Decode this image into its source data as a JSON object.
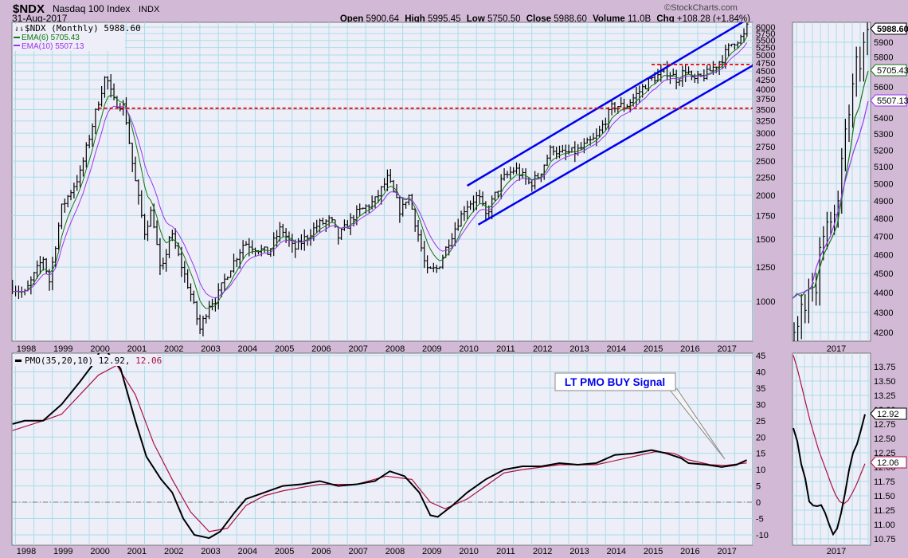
{
  "header": {
    "symbol": "$NDX",
    "name": "Nasdaq 100 Index",
    "exchange": "INDX",
    "date": "31-Aug-2017",
    "watermark": "©StockCharts.com",
    "open_label": "Open",
    "open": "5900.64",
    "high_label": "High",
    "high": "5995.45",
    "low_label": "Low",
    "low": "5750.50",
    "close_label": "Close",
    "close": "5988.60",
    "volume_label": "Volume",
    "volume": "11.0B",
    "chg_label": "Chg",
    "chg": "+108.28 (+1.84%)"
  },
  "legend": {
    "price": "$NDX (Monthly) 5988.60",
    "ema6": "EMA(6) 5705.43",
    "ema10": "EMA(10) 5507.13",
    "pmo": "PMO(35,20,10) 12.92,",
    "pmo_signal": "12.06"
  },
  "annotation": {
    "text": "LT PMO BUY Signal",
    "color": "#0000ee"
  },
  "colors": {
    "background": "#d2bad7",
    "panel": "#eeeef8",
    "grid": "#a8dde8",
    "ema6": "#117711",
    "ema10": "#9933ee",
    "pmo": "#000000",
    "signal": "#aa1144",
    "channel": "#0000ee",
    "support": "#ee0000"
  },
  "chart_data": [
    {
      "type": "ohlc",
      "title": "$NDX (Monthly)",
      "scale": "log",
      "ylim": [
        870,
        6300
      ],
      "y_ticks": [
        "6000",
        "5750",
        "5500",
        "5250",
        "5000",
        "4750",
        "4500",
        "4250",
        "4000",
        "3750",
        "3500",
        "3250",
        "3000",
        "2750",
        "2500",
        "2250",
        "2000",
        "1750",
        "1500",
        "1250",
        "1000"
      ],
      "x_ticks": [
        "1998",
        "1999",
        "2000",
        "2001",
        "2002",
        "2003",
        "2004",
        "2005",
        "2006",
        "2007",
        "2008",
        "2009",
        "2010",
        "2011",
        "2012",
        "2013",
        "2014",
        "2015",
        "2016",
        "2017"
      ],
      "xlim": [
        1997.67,
        2017.75
      ],
      "close_keypoints": [
        [
          1997.67,
          1100
        ],
        [
          1998.0,
          1050
        ],
        [
          1998.5,
          1330
        ],
        [
          1998.67,
          1140
        ],
        [
          1999.0,
          1840
        ],
        [
          1999.5,
          2300
        ],
        [
          2000.0,
          3700
        ],
        [
          2000.2,
          4400
        ],
        [
          2000.4,
          3700
        ],
        [
          2000.7,
          3570
        ],
        [
          2000.95,
          2340
        ],
        [
          2001.25,
          1570
        ],
        [
          2001.45,
          1830
        ],
        [
          2001.7,
          1170
        ],
        [
          2001.95,
          1580
        ],
        [
          2002.5,
          1050
        ],
        [
          2002.75,
          830
        ],
        [
          2003.0,
          985
        ],
        [
          2003.2,
          1020
        ],
        [
          2003.5,
          1200
        ],
        [
          2003.95,
          1470
        ],
        [
          2004.6,
          1370
        ],
        [
          2004.95,
          1620
        ],
        [
          2005.3,
          1400
        ],
        [
          2005.95,
          1650
        ],
        [
          2006.3,
          1700
        ],
        [
          2006.5,
          1520
        ],
        [
          2006.95,
          1760
        ],
        [
          2007.5,
          1930
        ],
        [
          2007.85,
          2240
        ],
        [
          2008.2,
          1780
        ],
        [
          2008.4,
          2030
        ],
        [
          2008.7,
          1500
        ],
        [
          2008.9,
          1210
        ],
        [
          2009.2,
          1240
        ],
        [
          2009.5,
          1480
        ],
        [
          2009.95,
          1860
        ],
        [
          2010.3,
          1990
        ],
        [
          2010.5,
          1750
        ],
        [
          2010.95,
          2220
        ],
        [
          2011.3,
          2380
        ],
        [
          2011.7,
          2150
        ],
        [
          2011.95,
          2280
        ],
        [
          2012.3,
          2750
        ],
        [
          2012.5,
          2620
        ],
        [
          2012.95,
          2660
        ],
        [
          2013.5,
          2910
        ],
        [
          2013.95,
          3590
        ],
        [
          2014.3,
          3580
        ],
        [
          2014.95,
          4240
        ],
        [
          2015.4,
          4500
        ],
        [
          2015.7,
          4260
        ],
        [
          2015.95,
          4590
        ],
        [
          2016.1,
          4200
        ],
        [
          2016.5,
          4420
        ],
        [
          2016.9,
          4870
        ],
        [
          2017.2,
          5440
        ],
        [
          2017.5,
          5650
        ],
        [
          2017.58,
          5988.6
        ]
      ],
      "series": [
        {
          "name": "EMA(6)",
          "last": 5705.43
        },
        {
          "name": "EMA(10)",
          "last": 5507.13
        }
      ],
      "trendlines": [
        {
          "name": "upper-channel",
          "from": [
            2010.0,
            2128
          ],
          "to": [
            2017.75,
            6455
          ]
        },
        {
          "name": "lower-channel",
          "from": [
            2010.3,
            1650
          ],
          "to": [
            2017.75,
            4674
          ]
        }
      ],
      "horizontal_lines": [
        {
          "name": "support-3500",
          "value": 3530,
          "from": 2000.0,
          "to": 2017.75
        },
        {
          "name": "resistance-4700",
          "value": 4700,
          "from": 2015.0,
          "to": 2017.75
        }
      ]
    },
    {
      "type": "line",
      "title": "PMO(35,20,10)",
      "ylim": [
        -12,
        45.5
      ],
      "y_ticks": [
        "45",
        "40",
        "35",
        "30",
        "25",
        "20",
        "15",
        "10",
        "5",
        "0",
        "-5",
        "-10"
      ],
      "zero_line": 0,
      "series": [
        {
          "name": "PMO",
          "last": 12.92,
          "points": [
            [
              1997.67,
              24
            ],
            [
              1998.0,
              25
            ],
            [
              1998.5,
              25
            ],
            [
              1999.0,
              30
            ],
            [
              1999.5,
              37
            ],
            [
              1999.9,
              43
            ],
            [
              2000.1,
              48
            ],
            [
              2000.6,
              41
            ],
            [
              2001.0,
              25
            ],
            [
              2001.3,
              14
            ],
            [
              2001.7,
              7
            ],
            [
              2002.0,
              3
            ],
            [
              2002.3,
              -5
            ],
            [
              2002.6,
              -10
            ],
            [
              2003.0,
              -11
            ],
            [
              2003.3,
              -9
            ],
            [
              2003.7,
              -3
            ],
            [
              2004.0,
              1
            ],
            [
              2004.5,
              3
            ],
            [
              2005.0,
              5
            ],
            [
              2005.5,
              5.5
            ],
            [
              2006.0,
              6.5
            ],
            [
              2006.5,
              5
            ],
            [
              2007.0,
              5.5
            ],
            [
              2007.5,
              6.5
            ],
            [
              2007.9,
              9.5
            ],
            [
              2008.3,
              8
            ],
            [
              2008.7,
              3
            ],
            [
              2009.0,
              -4
            ],
            [
              2009.2,
              -4.5
            ],
            [
              2009.6,
              -1
            ],
            [
              2010.0,
              3
            ],
            [
              2010.5,
              7
            ],
            [
              2011.0,
              10
            ],
            [
              2011.5,
              11
            ],
            [
              2012.0,
              11
            ],
            [
              2012.5,
              12
            ],
            [
              2013.0,
              11.5
            ],
            [
              2013.5,
              12
            ],
            [
              2014.0,
              14.5
            ],
            [
              2014.5,
              15
            ],
            [
              2015.0,
              16
            ],
            [
              2015.4,
              15
            ],
            [
              2015.8,
              13.5
            ],
            [
              2016.0,
              12
            ],
            [
              2016.5,
              11.5
            ],
            [
              2016.9,
              10.8
            ],
            [
              2017.3,
              11.5
            ],
            [
              2017.58,
              12.92
            ]
          ]
        },
        {
          "name": "Signal",
          "last": 12.06,
          "points": [
            [
              1997.67,
              22
            ],
            [
              1998.5,
              25
            ],
            [
              1999.0,
              27
            ],
            [
              1999.5,
              33
            ],
            [
              2000.0,
              39
            ],
            [
              2000.5,
              42
            ],
            [
              2001.0,
              33
            ],
            [
              2001.5,
              18
            ],
            [
              2002.0,
              7
            ],
            [
              2002.5,
              -3
            ],
            [
              2003.0,
              -9
            ],
            [
              2003.5,
              -8
            ],
            [
              2004.0,
              -1
            ],
            [
              2004.5,
              2
            ],
            [
              2005.0,
              3.5
            ],
            [
              2006.0,
              5.5
            ],
            [
              2007.0,
              5.5
            ],
            [
              2007.8,
              8
            ],
            [
              2008.5,
              7
            ],
            [
              2009.0,
              0
            ],
            [
              2009.4,
              -2
            ],
            [
              2010.0,
              1
            ],
            [
              2010.5,
              5
            ],
            [
              2011.0,
              9
            ],
            [
              2011.5,
              10
            ],
            [
              2012.5,
              11.5
            ],
            [
              2013.5,
              11.5
            ],
            [
              2014.5,
              14
            ],
            [
              2015.1,
              15.5
            ],
            [
              2015.6,
              15
            ],
            [
              2016.0,
              13
            ],
            [
              2016.6,
              11.5
            ],
            [
              2017.0,
              11.3
            ],
            [
              2017.58,
              12.06
            ]
          ]
        }
      ]
    },
    {
      "type": "ohlc",
      "title": "$NDX zoom 2017",
      "scale": "log",
      "ylim": [
        4150,
        6000
      ],
      "y_ticks": [
        "5900",
        "5800",
        "5600",
        "5400",
        "5300",
        "5200",
        "5100",
        "5000",
        "4900",
        "4800",
        "4700",
        "4600",
        "4500",
        "4400",
        "4300",
        "4200"
      ],
      "x_ticks": [
        "2017"
      ],
      "closes": [
        4200,
        4230,
        4340,
        4310,
        4420,
        4450,
        4400,
        4640,
        4700,
        4780,
        4780,
        4820,
        4900,
        5150,
        5330,
        5420,
        5620,
        5800,
        5720,
        5900,
        5988.6
      ],
      "ema6": [
        4370,
        4395,
        4380,
        4410,
        4420,
        4430,
        4520,
        4600,
        4650,
        4700,
        4760,
        4900,
        5050,
        5200,
        5400,
        5470,
        5600,
        5705.43
      ],
      "ema10": [
        4370,
        4390,
        4400,
        4410,
        4430,
        4530,
        4600,
        4650,
        4700,
        4780,
        4880,
        5000,
        5100,
        5200,
        5280,
        5380,
        5507.13
      ],
      "last_tags": [
        "5988.60",
        "5705.43",
        "5507.13"
      ]
    },
    {
      "type": "line",
      "title": "PMO zoom 2017",
      "ylim": [
        10.65,
        13.95
      ],
      "y_ticks": [
        "13.75",
        "13.50",
        "13.25",
        "13.00",
        "12.75",
        "12.50",
        "12.25",
        "12.00",
        "11.75",
        "11.50",
        "11.25",
        "11.00",
        "10.75"
      ],
      "x_ticks": [
        "2017"
      ],
      "pmo": [
        12.68,
        12.45,
        12.05,
        11.8,
        11.4,
        11.33,
        11.32,
        11.34,
        11.2,
        11.0,
        10.83,
        10.93,
        11.2,
        11.55,
        11.95,
        12.25,
        12.4,
        12.65,
        12.92
      ],
      "signal": [
        13.95,
        13.7,
        13.4,
        13.1,
        12.8,
        12.55,
        12.3,
        12.1,
        11.9,
        11.7,
        11.52,
        11.4,
        11.36,
        11.42,
        11.55,
        11.7,
        11.88,
        12.06
      ],
      "last_tags": [
        "12.92",
        "12.06"
      ]
    }
  ]
}
